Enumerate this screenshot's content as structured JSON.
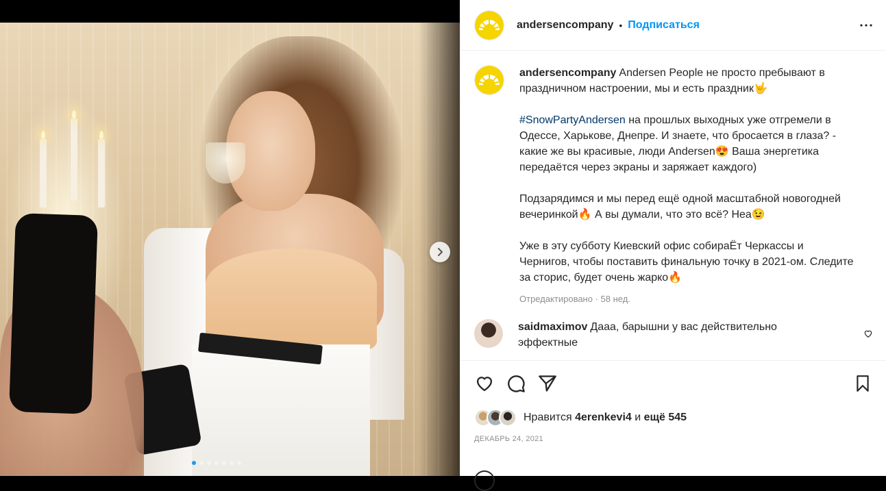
{
  "post": {
    "author": "andersencompany",
    "follow_label": "Подписаться",
    "separator": "•",
    "caption": {
      "line1": "Andersen People не просто пребывают в праздничном настроении, мы и есть праздник🤟",
      "hashtag": "#SnowPartyAndersen",
      "p2_rest": " на прошлых выходных уже отгремели  в Одессе, Харькове, Днепре. И знаете, что бросается в глаза? - какие же вы красивые, люди Andersen😍 Ваша энергетика передаётся через экраны и заряжает каждого)",
      "p3": "Подзарядимся и мы перед ещё одной масштабной новогодней вечеринкой🔥 А вы думали, что это всё? Неа😉",
      "p4": "Уже в эту субботу Киевский офис собираЁт Черкассы и Чернигов, чтобы поставить финальную точку в 2021-ом. Следите за сторис, будет очень жарко🔥"
    },
    "edited_meta": "Отредактировано · 58 нед.",
    "comment": {
      "user": "saidmaximov",
      "text": "Дааа, барышни у вас действительно эффектные"
    },
    "likes": {
      "prefix": "Нравится",
      "user": "4erenkevi4",
      "middle": "и",
      "rest": "ещё 545"
    },
    "date": "ДЕКАБРЬ 24, 2021"
  },
  "carousel": {
    "slide_count": 7,
    "active_index": 0
  },
  "colors": {
    "accent": "#0095f6",
    "logo_yellow": "#f5d400",
    "text": "#262626",
    "muted": "#8e8e8e",
    "hashtag": "#00376b"
  },
  "icons": [
    "more-options-icon",
    "like-heart-icon",
    "comment-icon",
    "share-icon",
    "save-bookmark-icon",
    "comment-like-icon",
    "next-arrow-icon"
  ]
}
